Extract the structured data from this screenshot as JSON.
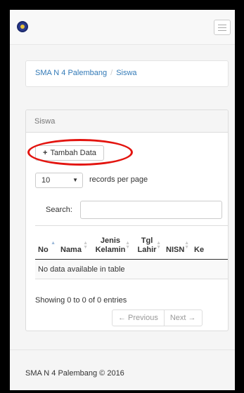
{
  "breadcrumb": {
    "school": "SMA N 4 Palembang",
    "separator": "/",
    "current": "Siswa"
  },
  "panel": {
    "title": "Siswa"
  },
  "toolbar": {
    "add_label": "Tambah Data"
  },
  "length": {
    "value": "10",
    "label": "records per page"
  },
  "search": {
    "label": "Search:",
    "value": ""
  },
  "table": {
    "columns": [
      {
        "line1": "",
        "line2": "No"
      },
      {
        "line1": "",
        "line2": "Nama"
      },
      {
        "line1": "Jenis",
        "line2": "Kelamin"
      },
      {
        "line1": "Tgl",
        "line2": "Lahir"
      },
      {
        "line1": "",
        "line2": "NISN"
      },
      {
        "line1": "",
        "line2": "Ke"
      }
    ],
    "empty_message": "No data available in table"
  },
  "info": "Showing 0 to 0 of 0 entries",
  "pagination": {
    "previous": "← Previous",
    "next": "Next →"
  },
  "footer": "SMA N 4 Palembang © 2016",
  "colors": {
    "highlight": "#e3140f",
    "link": "#337ab7"
  }
}
